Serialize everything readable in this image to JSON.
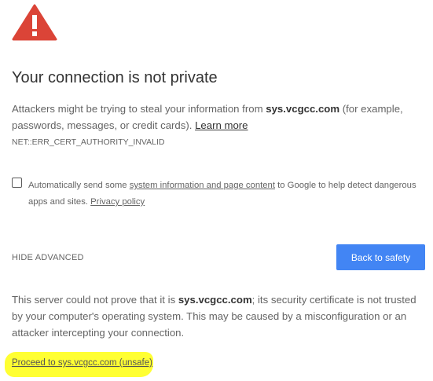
{
  "icon": "warning-triangle-icon",
  "colors": {
    "warning_red": "#db4437",
    "button_blue": "#4285f4",
    "highlight_yellow": "#ffff33"
  },
  "title": "Your connection is not private",
  "main_message": {
    "before": "Attackers might be trying to steal your information from ",
    "domain": "sys.vcgcc.com",
    "after": " (for example, passwords, messages, or credit cards). ",
    "learn_more": "Learn more"
  },
  "error_code": "NET::ERR_CERT_AUTHORITY_INVALID",
  "opt_in": {
    "before": "Automatically send some ",
    "link": "system information and page content",
    "after": " to Google to help detect dangerous apps and sites. ",
    "privacy_link": "Privacy policy",
    "checked": false
  },
  "hide_advanced": "HIDE ADVANCED",
  "back_button": "Back to safety",
  "details": {
    "before": "This server could not prove that it is ",
    "domain": "sys.vcgcc.com",
    "after": "; its security certificate is not trusted by your computer's operating system. This may be caused by a misconfiguration or an attacker intercepting your connection."
  },
  "proceed_link": "Proceed to sys.vcgcc.com (unsafe)"
}
